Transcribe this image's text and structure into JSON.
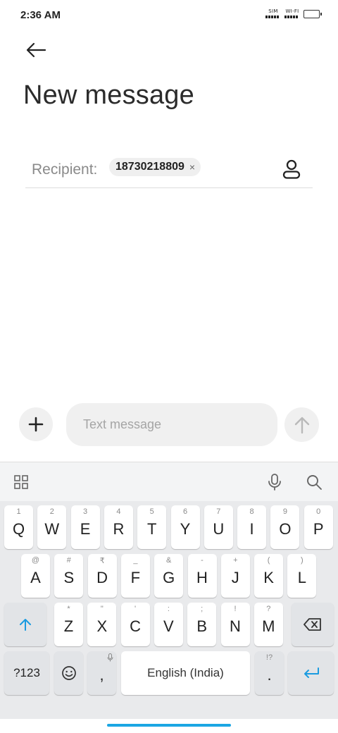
{
  "status_bar": {
    "time": "2:36 AM",
    "sim_label": "SIM",
    "wifi_label": "WI-FI"
  },
  "header": {
    "back_icon": "arrow-left-icon",
    "title": "New message"
  },
  "recipient": {
    "label": "Recipient:",
    "chips": [
      {
        "number": "18730218809",
        "remove": "×"
      }
    ],
    "contact_icon": "person-icon"
  },
  "compose": {
    "add_icon": "plus-icon",
    "placeholder": "Text message",
    "value": "",
    "send_icon": "arrow-up-icon"
  },
  "keyboard": {
    "toolbar": {
      "grid_icon": "apps-grid-icon",
      "mic_icon": "microphone-icon",
      "search_icon": "search-icon"
    },
    "row1": [
      {
        "k": "Q",
        "s": "1"
      },
      {
        "k": "W",
        "s": "2"
      },
      {
        "k": "E",
        "s": "3"
      },
      {
        "k": "R",
        "s": "4"
      },
      {
        "k": "T",
        "s": "5"
      },
      {
        "k": "Y",
        "s": "6"
      },
      {
        "k": "U",
        "s": "7"
      },
      {
        "k": "I",
        "s": "8"
      },
      {
        "k": "O",
        "s": "9"
      },
      {
        "k": "P",
        "s": "0"
      }
    ],
    "row2": [
      {
        "k": "A",
        "s": "@"
      },
      {
        "k": "S",
        "s": "#"
      },
      {
        "k": "D",
        "s": "₹"
      },
      {
        "k": "F",
        "s": "_"
      },
      {
        "k": "G",
        "s": "&"
      },
      {
        "k": "H",
        "s": "-"
      },
      {
        "k": "J",
        "s": "+"
      },
      {
        "k": "K",
        "s": "("
      },
      {
        "k": "L",
        "s": ")"
      }
    ],
    "row3": [
      {
        "k": "Z",
        "s": "*"
      },
      {
        "k": "X",
        "s": "\""
      },
      {
        "k": "C",
        "s": "'"
      },
      {
        "k": "V",
        "s": ":"
      },
      {
        "k": "B",
        "s": ";"
      },
      {
        "k": "N",
        "s": "!"
      },
      {
        "k": "M",
        "s": "?"
      }
    ],
    "shift_icon": "shift-arrow-icon",
    "backspace_icon": "backspace-icon",
    "symbols_label": "?123",
    "emoji_icon": "emoji-icon",
    "comma": ",",
    "comma_icon": "microphone-icon",
    "space_label": "English (India)",
    "period": ".",
    "period_sub": "!?",
    "enter_icon": "enter-icon",
    "accent_color": "#1a9be0"
  }
}
